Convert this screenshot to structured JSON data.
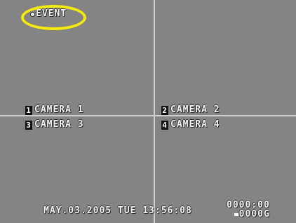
{
  "overlay": {
    "event_label": "EVENT"
  },
  "cameras": [
    {
      "num": "1",
      "label": "CAMERA 1"
    },
    {
      "num": "2",
      "label": "CAMERA 2"
    },
    {
      "num": "3",
      "label": "CAMERA 3"
    },
    {
      "num": "4",
      "label": "CAMERA 4"
    }
  ],
  "status": {
    "datetime": "MAY.03.2005 TUE 13:56:08",
    "time_counter": "0000:00",
    "record_counter": "0000G"
  },
  "colors": {
    "highlight_ring": "#f5ea0a",
    "video_background": "#848484",
    "grid_lines": "#cfcfcf"
  }
}
